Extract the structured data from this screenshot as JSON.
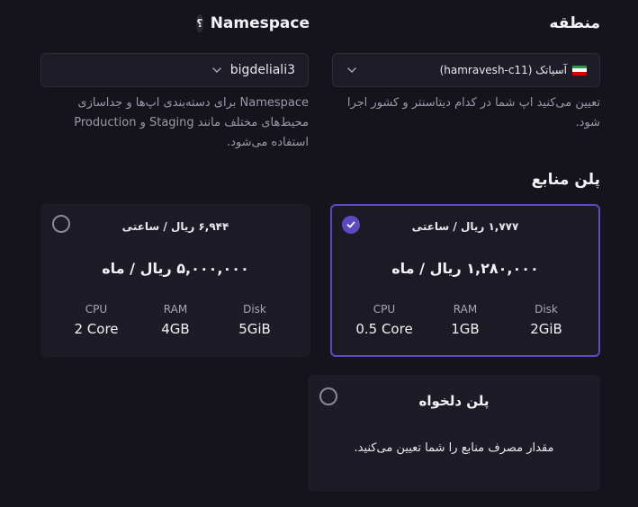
{
  "region": {
    "title": "منطقه",
    "selected_label": "آسیاتک (hamravesh-c11)",
    "hint": "تعیین می‌کنید اپ شما در کدام دیتاسنتر و کشور اجرا شود."
  },
  "namespace": {
    "title": "Namespace",
    "help": "؟",
    "selected_value": "bigdeliali3",
    "hint": "Namespace برای دسته‌بندی اپ‌ها و جداسازی محیط‌های مختلف مانند Staging و Production استفاده می‌شود."
  },
  "plans": {
    "title": "پلن منابع",
    "cards": [
      {
        "hourly": "۱,۷۷۷ ریال / ساعتی",
        "monthly": "۱,۲۸۰,۰۰۰ ریال / ماه",
        "selected": true,
        "specs": [
          {
            "label": "Disk",
            "value": "2GiB"
          },
          {
            "label": "RAM",
            "value": "1GB"
          },
          {
            "label": "CPU",
            "value": "0.5 Core"
          }
        ]
      },
      {
        "hourly": "۶,۹۴۴ ریال / ساعتی",
        "monthly": "۵,۰۰۰,۰۰۰ ریال / ماه",
        "selected": false,
        "specs": [
          {
            "label": "Disk",
            "value": "5GiB"
          },
          {
            "label": "RAM",
            "value": "4GB"
          },
          {
            "label": "CPU",
            "value": "2 Core"
          }
        ]
      }
    ],
    "custom": {
      "title": "پلن دلخواه",
      "description": "مقدار مصرف منابع را شما تعیین می‌کنید."
    }
  },
  "colors": {
    "background": "#15141c",
    "card": "#1d1c26",
    "accent": "#5b4ac2"
  }
}
